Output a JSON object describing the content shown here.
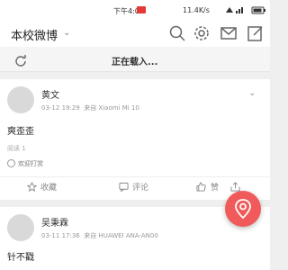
{
  "statusbar": {
    "time": "下午4:00",
    "network_speed": "11.4K/s"
  },
  "header": {
    "title": "本校微博"
  },
  "loading": {
    "text": "正在载入..."
  },
  "posts": [
    {
      "author": "黄文",
      "date": "03-12 19:29",
      "source": "来自 Xiaomi Mi 10",
      "content": "爽歪歪",
      "reads": "阅读 1",
      "reward": "欢迎打赏",
      "actions": {
        "collect": "收藏",
        "comment": "评论",
        "like": "赞"
      }
    },
    {
      "author": "吴秉霖",
      "date": "03-11 17:36",
      "source": "来自 HUAWEI ANA-AN00",
      "content": "针不戳"
    }
  ],
  "colors": {
    "accent": "#f05a5a",
    "background": "#efefef"
  }
}
